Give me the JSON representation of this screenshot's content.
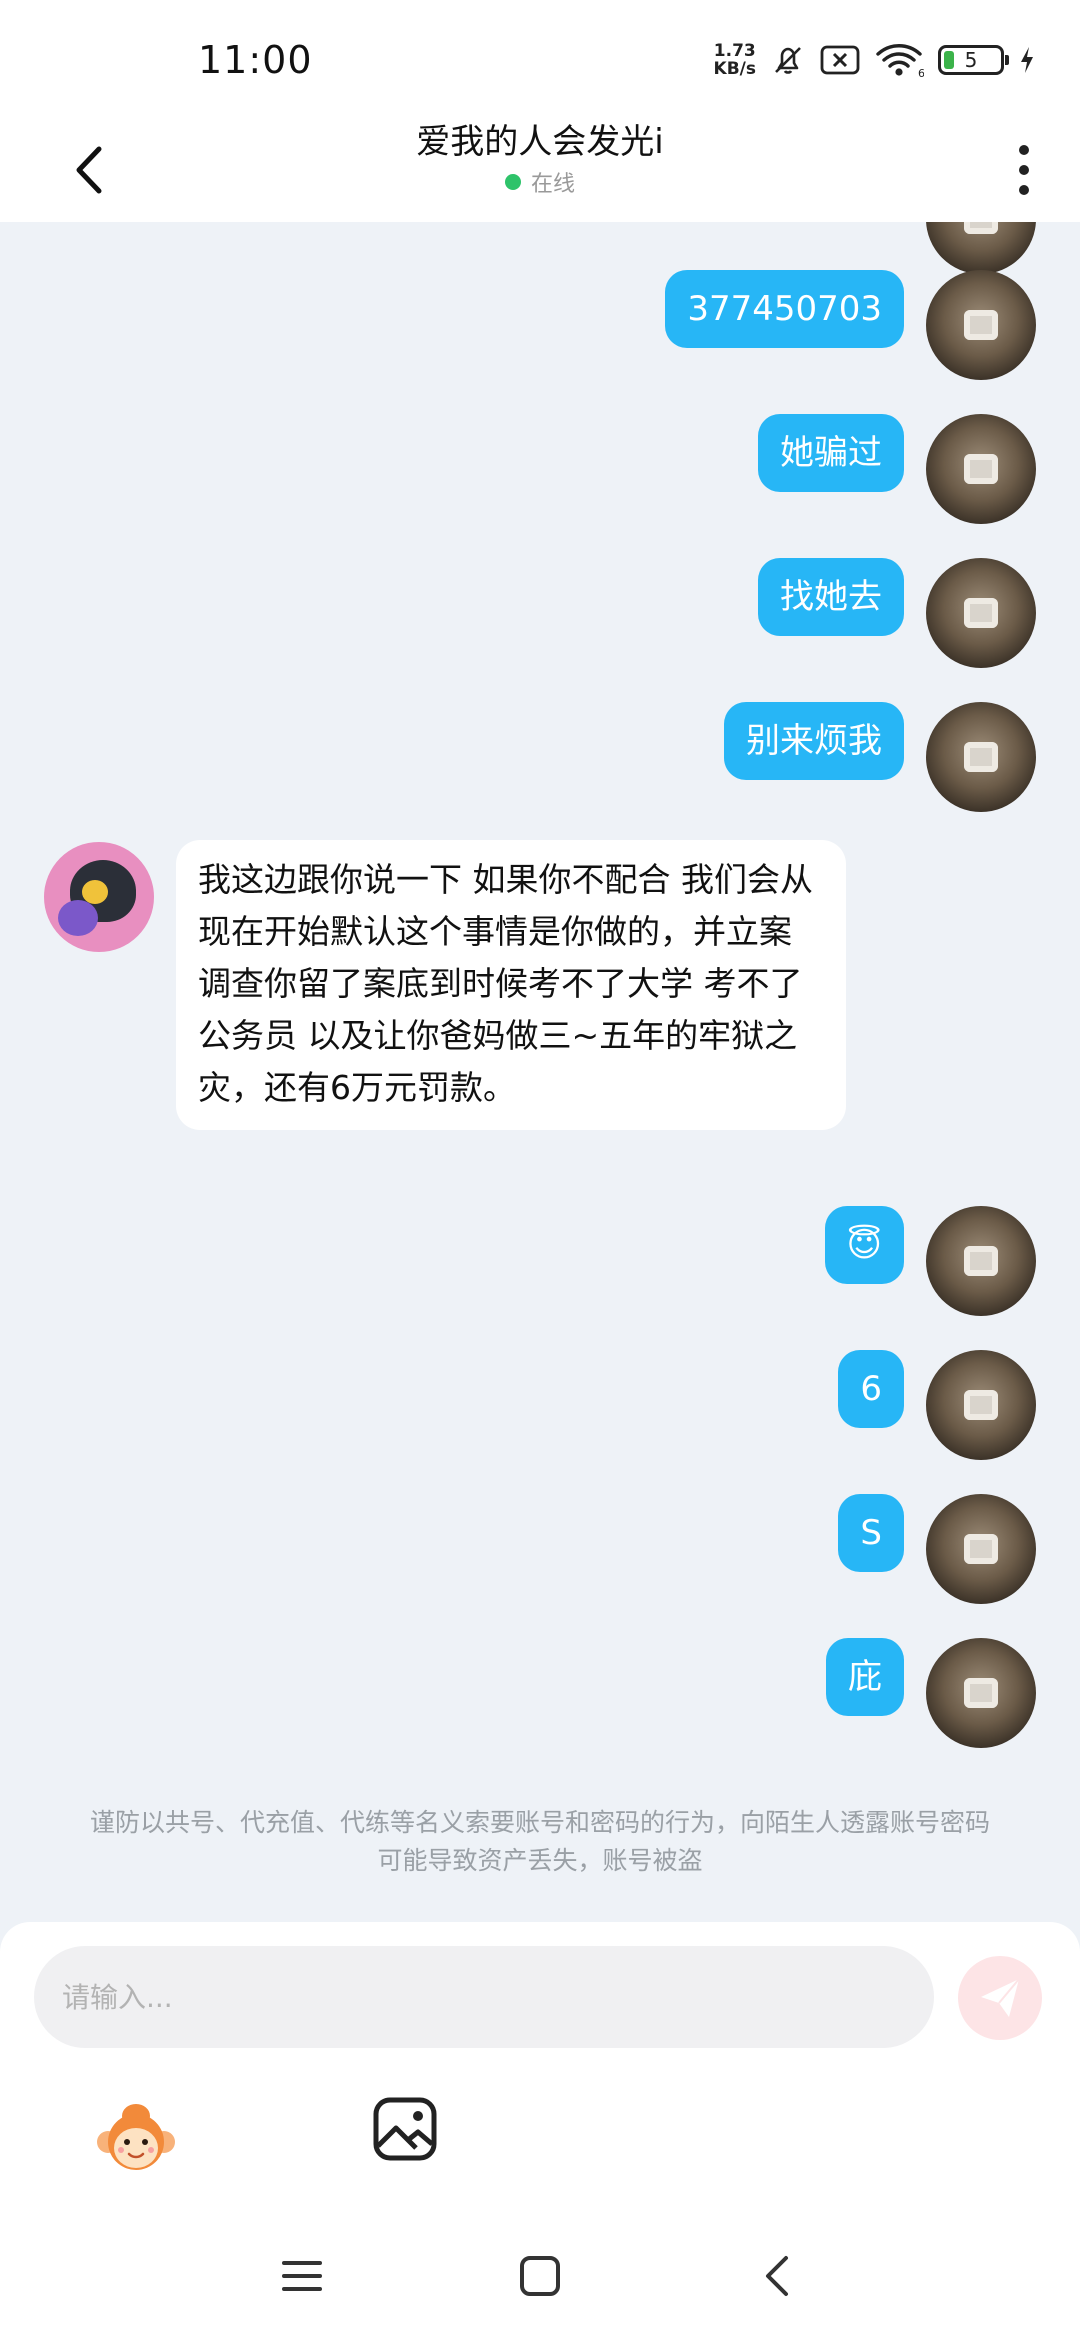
{
  "status_bar": {
    "time": "11:00",
    "net_speed_value": "1.73",
    "net_speed_unit": "KB/s",
    "battery_level": "5",
    "wifi_label": "6"
  },
  "header": {
    "title": "爱我的人会发光i",
    "status": "在线"
  },
  "messages": {
    "m1": "377450703",
    "m2": "她骗过",
    "m3": "找她去",
    "m4": "别来烦我",
    "incoming": "我这边跟你说一下 如果你不配合 我们会从现在开始默认这个事情是你做的，并立案调查你留了案底到时候考不了大学 考不了公务员 以及让你爸妈做三~五年的牢狱之灾，还有6万元罚款。",
    "m5": "😇",
    "m6": "6",
    "m7": "S",
    "m8": "庇"
  },
  "warning": "谨防以共号、代充值、代练等名义索要账号和密码的行为，向陌生人透露账号密码可能导致资产丢失，账号被盗",
  "input": {
    "placeholder": "请输入..."
  },
  "colors": {
    "sent_bubble": "#27b6f6",
    "received_bubble": "#ffffff",
    "chat_background": "#eef2f7",
    "online": "#2ec36a",
    "send_button": "#fde4e6"
  },
  "icons": {
    "back": "back-arrow-icon",
    "more": "more-vertical-icon",
    "emoji": "monkey-emoji-icon",
    "image": "image-icon",
    "send": "send-plane-icon",
    "nav_menu": "menu-icon",
    "nav_home": "home-icon",
    "nav_back": "back-icon"
  }
}
